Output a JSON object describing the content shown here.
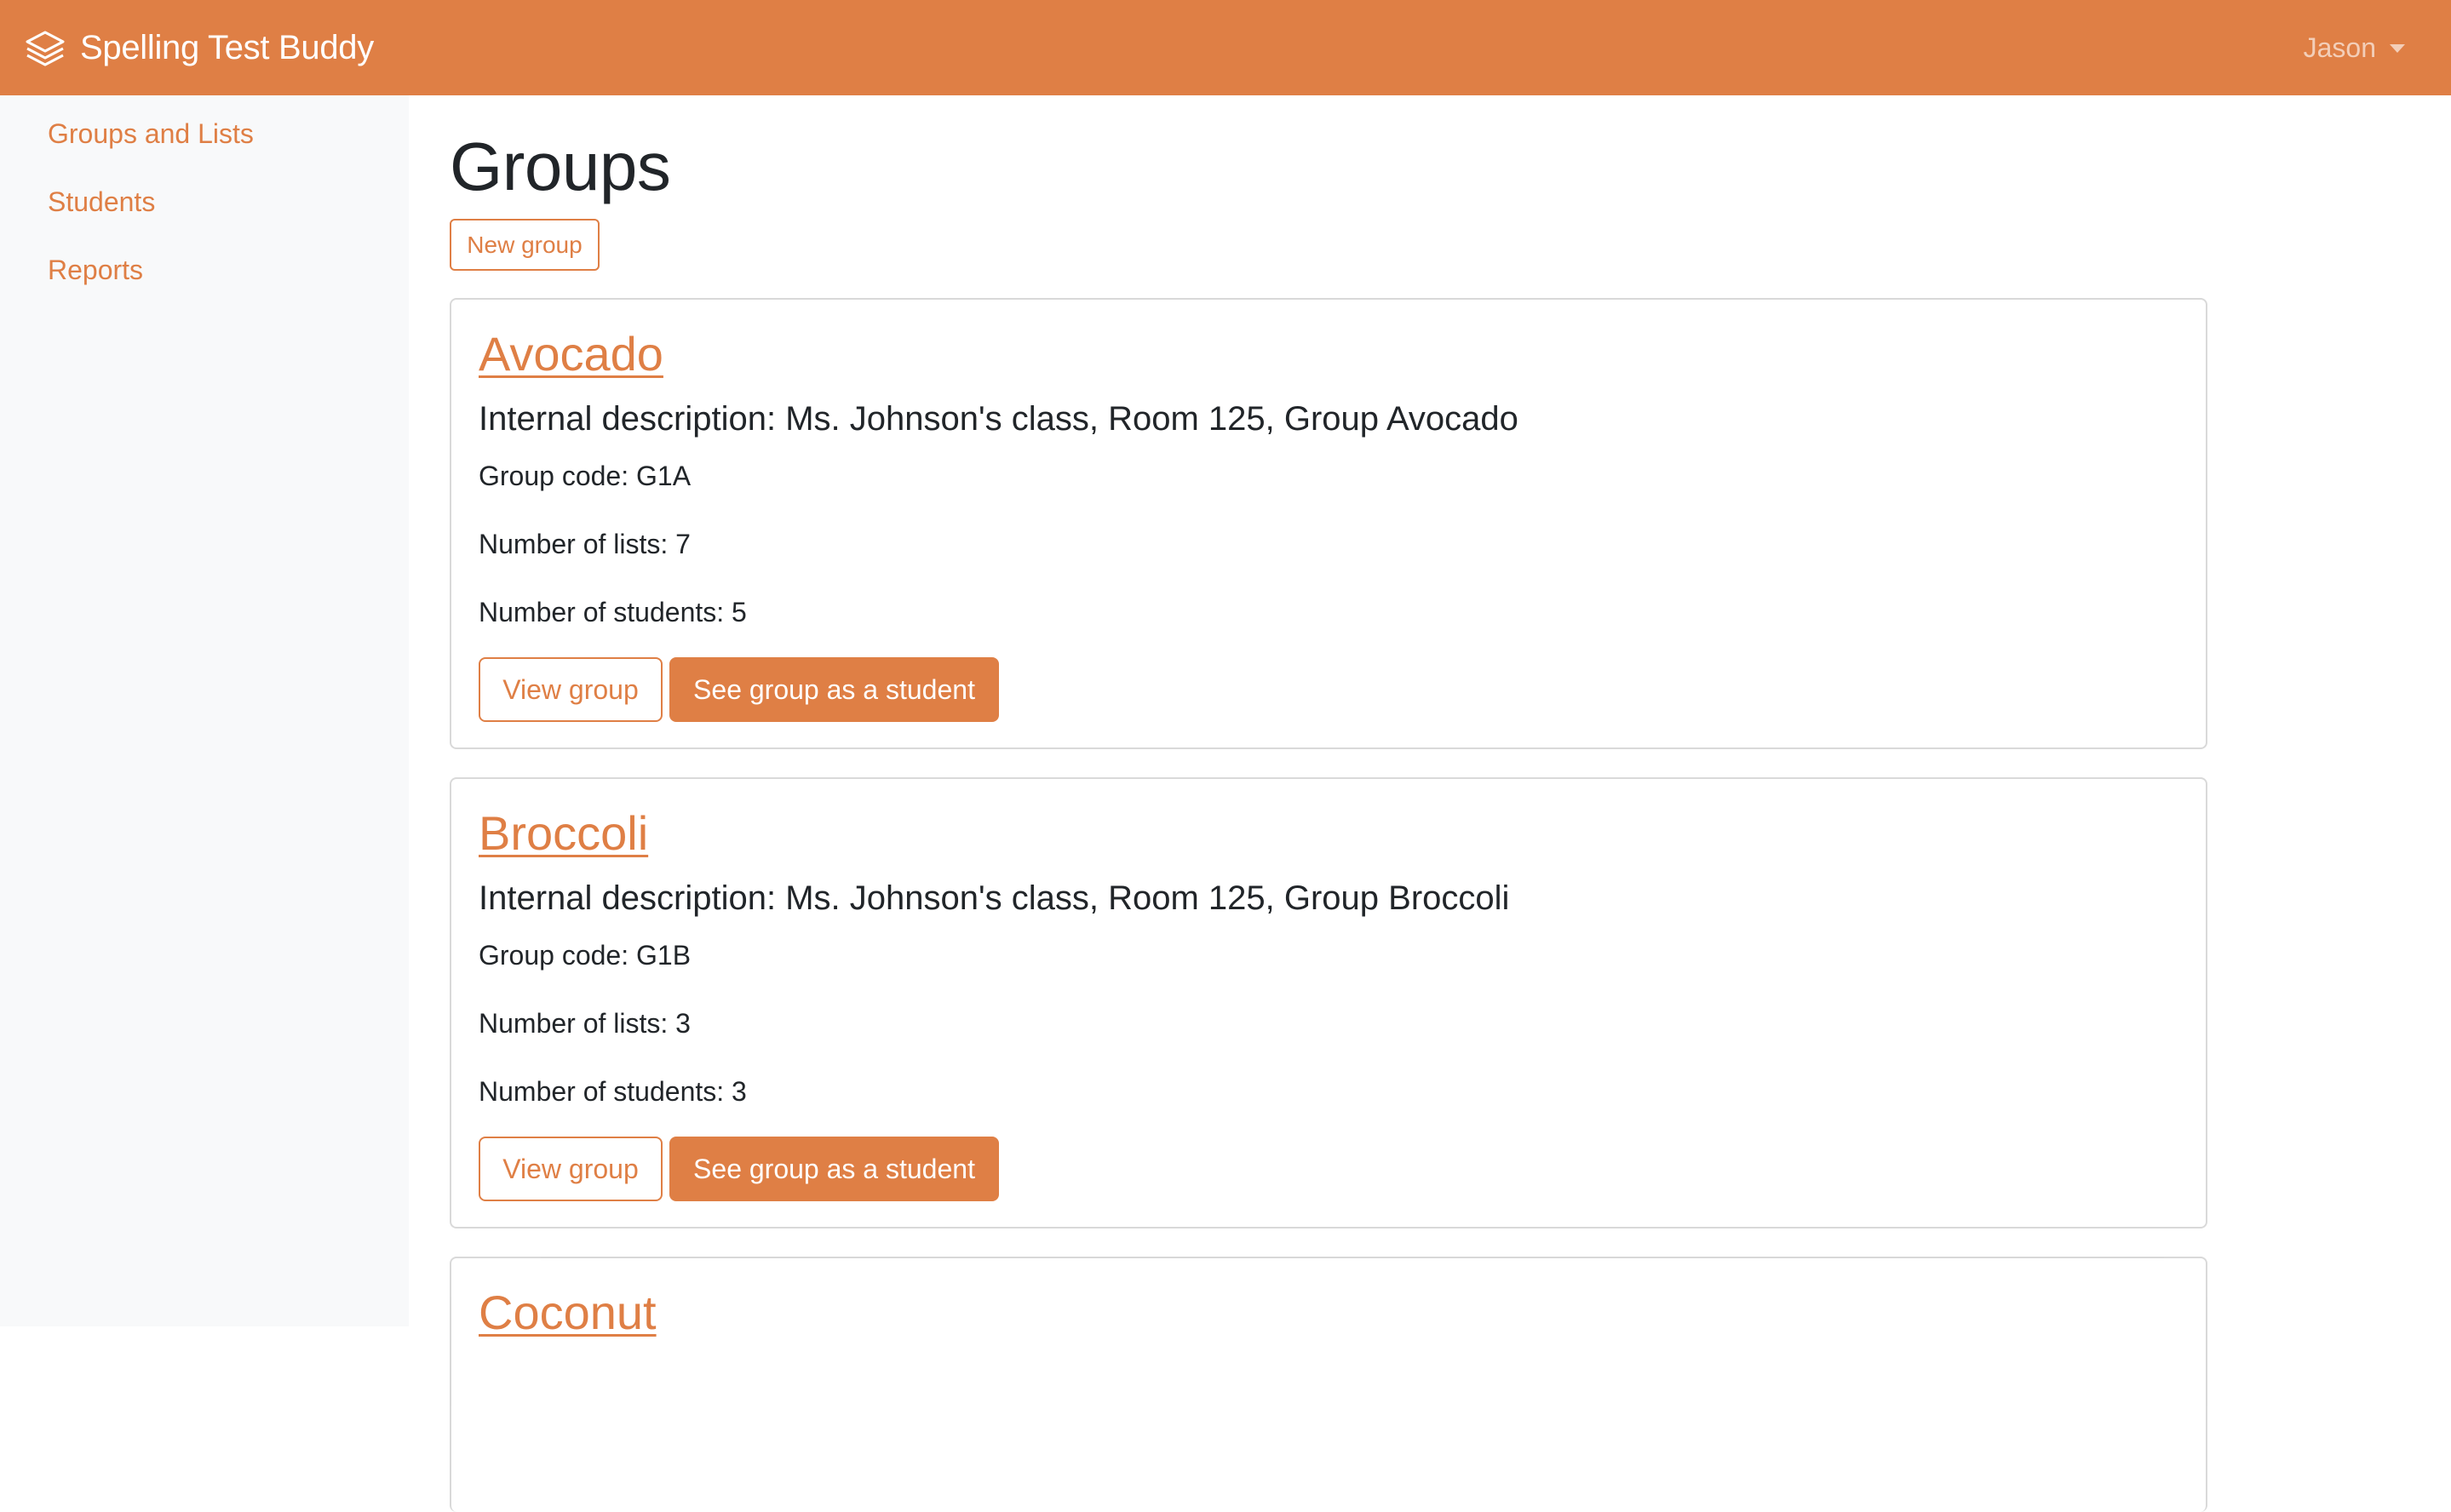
{
  "navbar": {
    "brand_icon": "layers-icon",
    "brand": "Spelling Test Buddy",
    "user": "Jason",
    "user_menu_icon": "caret-down-icon"
  },
  "colors": {
    "accent": "#df7f45",
    "sidebar_bg": "#f8f9fa",
    "text": "#212529"
  },
  "sidebar": {
    "items": [
      {
        "label": "Groups and Lists"
      },
      {
        "label": "Students"
      },
      {
        "label": "Reports"
      }
    ]
  },
  "main": {
    "title": "Groups",
    "new_group_label": "New group",
    "groups": [
      {
        "name": "Avocado",
        "description": "Internal description: Ms. Johnson's class, Room 125, Group Avocado",
        "code": "Group code: G1A",
        "lists": "Number of lists: 7",
        "students": "Number of students: 5",
        "view_label": "View group",
        "student_view_label": "See group as a student"
      },
      {
        "name": "Broccoli",
        "description": "Internal description: Ms. Johnson's class, Room 125, Group Broccoli",
        "code": "Group code: G1B",
        "lists": "Number of lists: 3",
        "students": "Number of students: 3",
        "view_label": "View group",
        "student_view_label": "See group as a student"
      },
      {
        "name": "Coconut"
      }
    ]
  }
}
